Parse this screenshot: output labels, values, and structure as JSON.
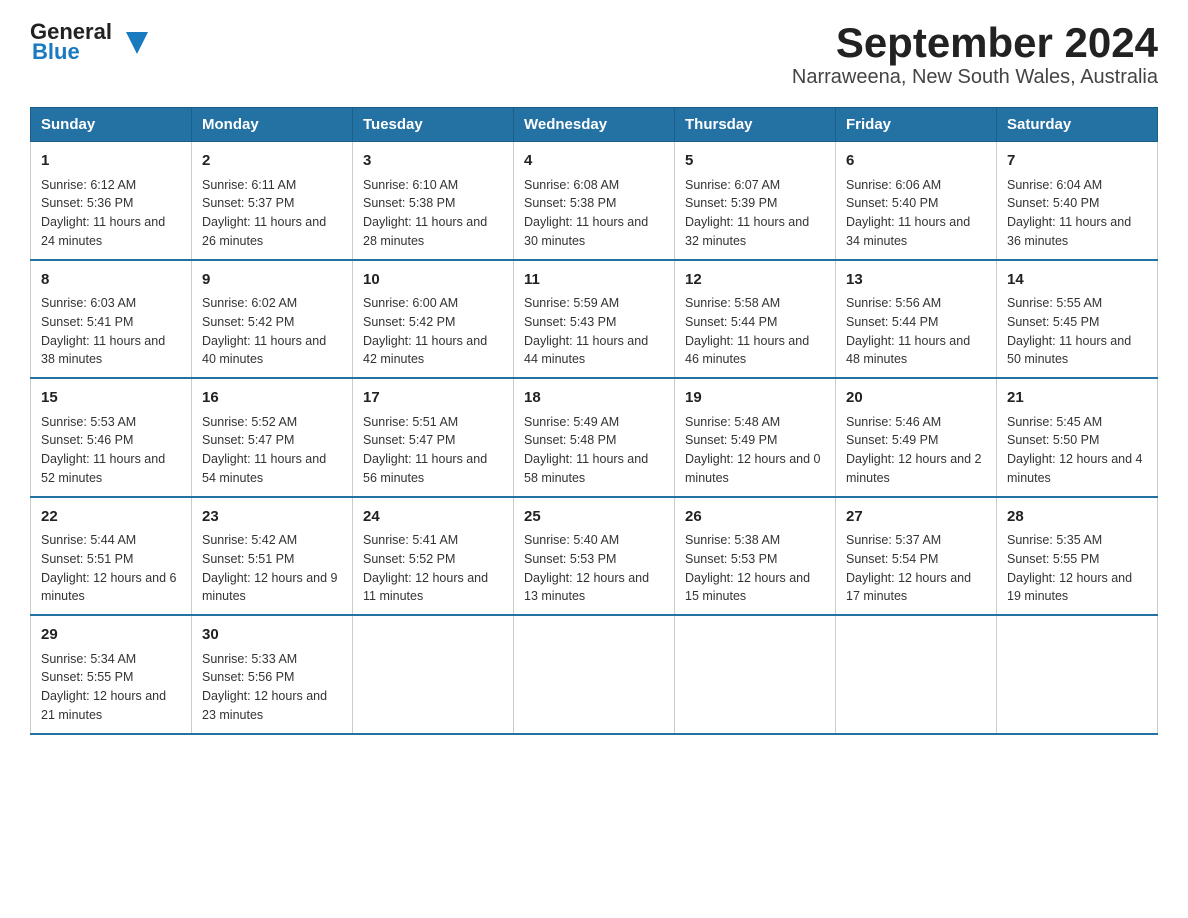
{
  "logo": {
    "text_general": "General",
    "text_blue": "Blue",
    "triangle": true
  },
  "title": "September 2024",
  "subtitle": "Narraweena, New South Wales, Australia",
  "days_of_week": [
    "Sunday",
    "Monday",
    "Tuesday",
    "Wednesday",
    "Thursday",
    "Friday",
    "Saturday"
  ],
  "weeks": [
    [
      {
        "day": "1",
        "sunrise": "6:12 AM",
        "sunset": "5:36 PM",
        "daylight": "11 hours and 24 minutes."
      },
      {
        "day": "2",
        "sunrise": "6:11 AM",
        "sunset": "5:37 PM",
        "daylight": "11 hours and 26 minutes."
      },
      {
        "day": "3",
        "sunrise": "6:10 AM",
        "sunset": "5:38 PM",
        "daylight": "11 hours and 28 minutes."
      },
      {
        "day": "4",
        "sunrise": "6:08 AM",
        "sunset": "5:38 PM",
        "daylight": "11 hours and 30 minutes."
      },
      {
        "day": "5",
        "sunrise": "6:07 AM",
        "sunset": "5:39 PM",
        "daylight": "11 hours and 32 minutes."
      },
      {
        "day": "6",
        "sunrise": "6:06 AM",
        "sunset": "5:40 PM",
        "daylight": "11 hours and 34 minutes."
      },
      {
        "day": "7",
        "sunrise": "6:04 AM",
        "sunset": "5:40 PM",
        "daylight": "11 hours and 36 minutes."
      }
    ],
    [
      {
        "day": "8",
        "sunrise": "6:03 AM",
        "sunset": "5:41 PM",
        "daylight": "11 hours and 38 minutes."
      },
      {
        "day": "9",
        "sunrise": "6:02 AM",
        "sunset": "5:42 PM",
        "daylight": "11 hours and 40 minutes."
      },
      {
        "day": "10",
        "sunrise": "6:00 AM",
        "sunset": "5:42 PM",
        "daylight": "11 hours and 42 minutes."
      },
      {
        "day": "11",
        "sunrise": "5:59 AM",
        "sunset": "5:43 PM",
        "daylight": "11 hours and 44 minutes."
      },
      {
        "day": "12",
        "sunrise": "5:58 AM",
        "sunset": "5:44 PM",
        "daylight": "11 hours and 46 minutes."
      },
      {
        "day": "13",
        "sunrise": "5:56 AM",
        "sunset": "5:44 PM",
        "daylight": "11 hours and 48 minutes."
      },
      {
        "day": "14",
        "sunrise": "5:55 AM",
        "sunset": "5:45 PM",
        "daylight": "11 hours and 50 minutes."
      }
    ],
    [
      {
        "day": "15",
        "sunrise": "5:53 AM",
        "sunset": "5:46 PM",
        "daylight": "11 hours and 52 minutes."
      },
      {
        "day": "16",
        "sunrise": "5:52 AM",
        "sunset": "5:47 PM",
        "daylight": "11 hours and 54 minutes."
      },
      {
        "day": "17",
        "sunrise": "5:51 AM",
        "sunset": "5:47 PM",
        "daylight": "11 hours and 56 minutes."
      },
      {
        "day": "18",
        "sunrise": "5:49 AM",
        "sunset": "5:48 PM",
        "daylight": "11 hours and 58 minutes."
      },
      {
        "day": "19",
        "sunrise": "5:48 AM",
        "sunset": "5:49 PM",
        "daylight": "12 hours and 0 minutes."
      },
      {
        "day": "20",
        "sunrise": "5:46 AM",
        "sunset": "5:49 PM",
        "daylight": "12 hours and 2 minutes."
      },
      {
        "day": "21",
        "sunrise": "5:45 AM",
        "sunset": "5:50 PM",
        "daylight": "12 hours and 4 minutes."
      }
    ],
    [
      {
        "day": "22",
        "sunrise": "5:44 AM",
        "sunset": "5:51 PM",
        "daylight": "12 hours and 6 minutes."
      },
      {
        "day": "23",
        "sunrise": "5:42 AM",
        "sunset": "5:51 PM",
        "daylight": "12 hours and 9 minutes."
      },
      {
        "day": "24",
        "sunrise": "5:41 AM",
        "sunset": "5:52 PM",
        "daylight": "12 hours and 11 minutes."
      },
      {
        "day": "25",
        "sunrise": "5:40 AM",
        "sunset": "5:53 PM",
        "daylight": "12 hours and 13 minutes."
      },
      {
        "day": "26",
        "sunrise": "5:38 AM",
        "sunset": "5:53 PM",
        "daylight": "12 hours and 15 minutes."
      },
      {
        "day": "27",
        "sunrise": "5:37 AM",
        "sunset": "5:54 PM",
        "daylight": "12 hours and 17 minutes."
      },
      {
        "day": "28",
        "sunrise": "5:35 AM",
        "sunset": "5:55 PM",
        "daylight": "12 hours and 19 minutes."
      }
    ],
    [
      {
        "day": "29",
        "sunrise": "5:34 AM",
        "sunset": "5:55 PM",
        "daylight": "12 hours and 21 minutes."
      },
      {
        "day": "30",
        "sunrise": "5:33 AM",
        "sunset": "5:56 PM",
        "daylight": "12 hours and 23 minutes."
      },
      null,
      null,
      null,
      null,
      null
    ]
  ]
}
